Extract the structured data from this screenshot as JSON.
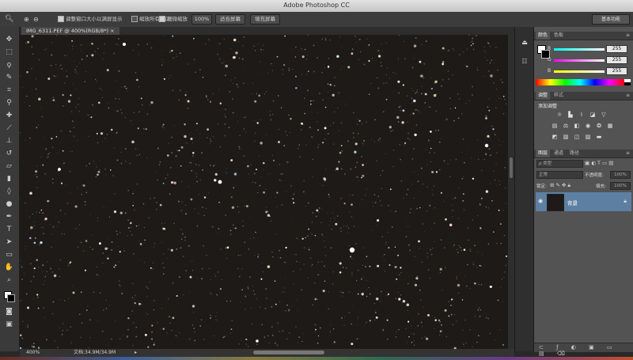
{
  "app": {
    "title": "Adobe Photoshop CC"
  },
  "options_bar": {
    "check1_label": "调整窗口大小以满屏显示",
    "check2_label": "缩放所有窗口",
    "check3_label": "细微缩放",
    "zoom_value": "100%",
    "fit_screen_button": "适合屏幕",
    "fill_screen_button": "填充屏幕",
    "workspace": "基本功能"
  },
  "document": {
    "tab_label": "IMG_6311.PEF @ 400%(RGB/8*)"
  },
  "status": {
    "zoom": "400%",
    "doc_info": "文档:34.9M/34.9M"
  },
  "color_panel": {
    "tabs": [
      "颜色",
      "色板"
    ],
    "channels": [
      {
        "label": "R",
        "value": "255"
      },
      {
        "label": "G",
        "value": "255"
      },
      {
        "label": "B",
        "value": "255"
      }
    ]
  },
  "adjust_panel": {
    "tabs": [
      "调整",
      "样式"
    ],
    "heading": "添加调整"
  },
  "layers_panel": {
    "tabs": [
      "图层",
      "通道",
      "路径"
    ],
    "kind_filter": "ρ 类型",
    "blend_mode": "正常",
    "opacity_label": "不透明度:",
    "opacity_value": "100%",
    "lock_label": "锁定:",
    "fill_label": "填充:",
    "fill_value": "100%",
    "layer_name": "背景"
  },
  "colors": {
    "accent": "#5d7fa2",
    "panel_bg": "#535353",
    "canvas_bg": "#1d1a17"
  }
}
